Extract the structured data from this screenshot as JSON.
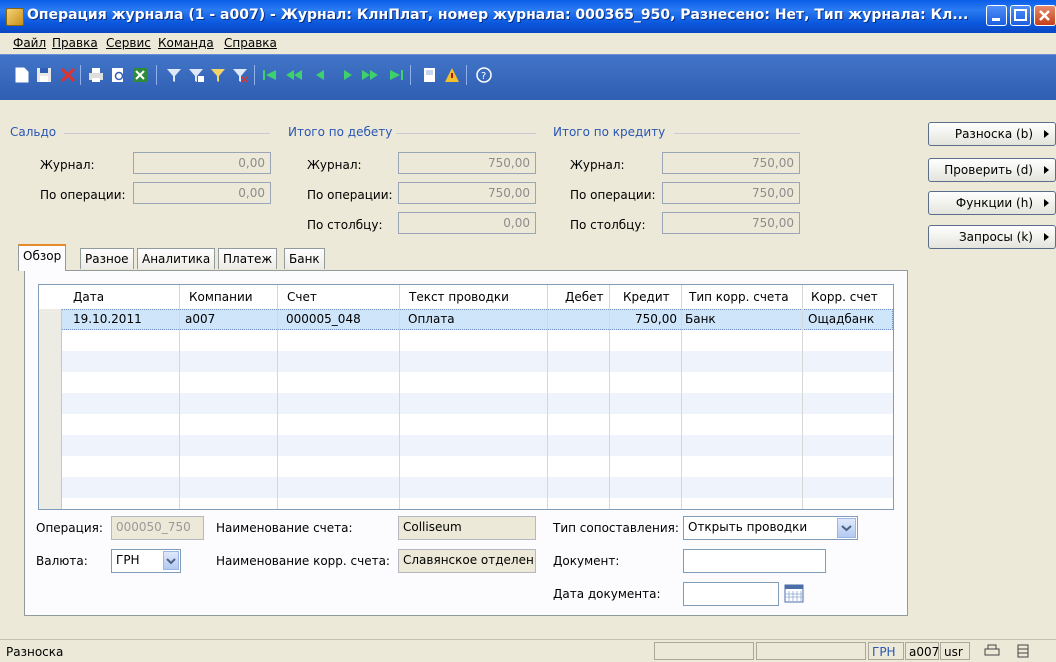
{
  "window": {
    "title": "Операция журнала (1 - a007) - Журнал: КлнПлат, номер журнала: 000365_950, Разнесено: Нет, Тип журнала: Кл..."
  },
  "menu": [
    "Файл",
    "Правка",
    "Сервис",
    "Команда",
    "Справка"
  ],
  "toolbar": {
    "icons": [
      "new-icon",
      "save-icon",
      "delete-icon",
      "print-icon",
      "print-preview-icon",
      "export-excel-icon",
      "filter-by-selection-icon",
      "filter-by-grid-icon",
      "advanced-filter-icon",
      "remove-filter-icon",
      "first-record-icon",
      "previous-page-icon",
      "previous-record-icon",
      "next-record-icon",
      "next-page-icon",
      "last-record-icon",
      "document-handling-icon",
      "alert-icon",
      "help-icon"
    ]
  },
  "balance": {
    "saldo_label": "Сальдо",
    "debit_label": "Итого по дебету",
    "credit_label": "Итого по кредиту",
    "journal_label": "Журнал:",
    "operation_label": "По операции:",
    "column_label": "По столбцу:",
    "saldo_journal": "0,00",
    "saldo_operation": "0,00",
    "debit_journal": "750,00",
    "debit_operation": "750,00",
    "debit_column": "0,00",
    "credit_journal": "750,00",
    "credit_operation": "750,00",
    "credit_column": "750,00"
  },
  "side_buttons": {
    "posting": "Разноска (b)",
    "check": "Проверить (d)",
    "functions": "Функции (h)",
    "inquiries": "Запросы (k)"
  },
  "tabs": [
    "Обзор",
    "Разное",
    "Аналитика",
    "Платеж",
    "Банк"
  ],
  "grid": {
    "headers": [
      "Дата",
      "Компании",
      "Счет",
      "Текст проводки",
      "Дебет",
      "Кредит",
      "Тип корр. счета",
      "Корр. счет"
    ],
    "rows": [
      [
        "19.10.2011",
        "a007",
        "000005_048",
        "Оплата",
        "",
        "750,00",
        "Банк",
        "Ощадбанк"
      ]
    ]
  },
  "details": {
    "operation_label": "Операция:",
    "operation_value": "000050_750",
    "currency_label": "Валюта:",
    "currency_value": "ГРН",
    "account_name_label": "Наименование счета:",
    "account_name_value": "Colliseum",
    "corr_account_name_label": "Наименование корр. счета:",
    "corr_account_name_value": "Славянское отделен",
    "match_type_label": "Тип сопоставления:",
    "match_type_value": "Открыть проводки",
    "document_label": "Документ:",
    "document_value": "",
    "document_date_label": "Дата документа:",
    "document_date_value": ""
  },
  "status": {
    "text": "Разноска",
    "currency": "ГРН",
    "company": "a007",
    "user": "usr"
  }
}
